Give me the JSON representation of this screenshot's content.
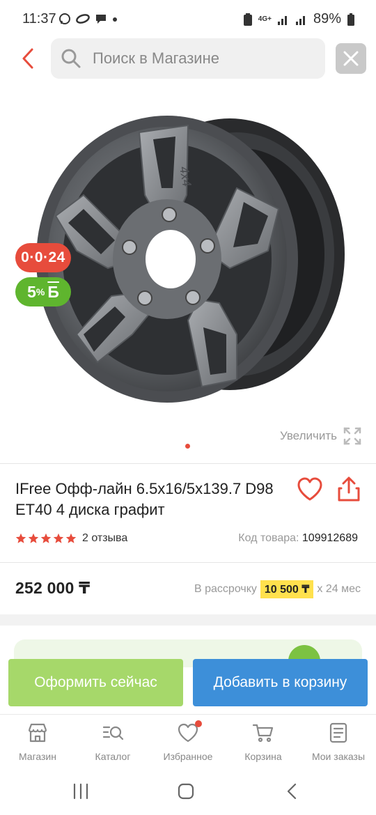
{
  "status_bar": {
    "time": "11:37",
    "network": "4G+",
    "battery": "89%"
  },
  "header": {
    "search_placeholder": "Поиск в Магазине"
  },
  "gallery": {
    "badge_credit": "0·0·24",
    "badge_bonus_value": "5",
    "badge_bonus_suffix": "%",
    "badge_bonus_letter": "Б",
    "zoom_label": "Увеличить",
    "wheel_marking": "4x4"
  },
  "product": {
    "title": "IFree Офф-лайн 6.5x16/5x139.7 D98 ET40 4 диска графит",
    "rating_stars": 5,
    "reviews": "2 отзыва",
    "code_label": "Код товара:",
    "code_value": "109912689",
    "price": "252 000 ₸",
    "installment_prefix": "В рассрочку",
    "installment_amount": "10 500 ₸",
    "installment_suffix": "x 24 мес"
  },
  "actions": {
    "buy_now": "Оформить сейчас",
    "add_to_cart": "Добавить в корзину"
  },
  "bottom_nav": [
    {
      "label": "Магазин",
      "icon": "store-icon"
    },
    {
      "label": "Каталог",
      "icon": "catalog-search-icon"
    },
    {
      "label": "Избранное",
      "icon": "heart-icon"
    },
    {
      "label": "Корзина",
      "icon": "cart-icon"
    },
    {
      "label": "Мои заказы",
      "icon": "orders-icon"
    }
  ],
  "colors": {
    "accent_red": "#e74c3c",
    "bonus_green": "#5fb52e",
    "buy_now_green": "#a6d86a",
    "cart_blue": "#3d8fd9",
    "installment_yellow": "#ffe14d"
  }
}
